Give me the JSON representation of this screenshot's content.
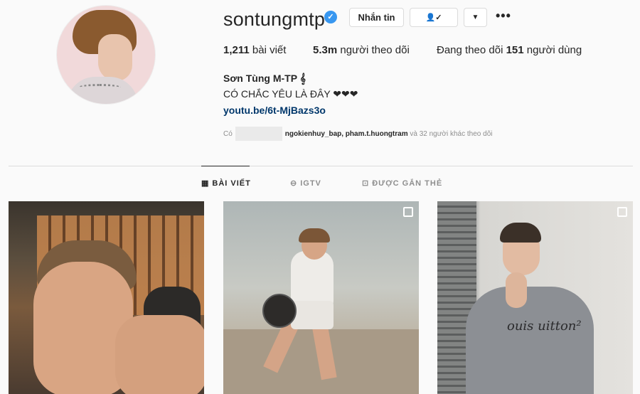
{
  "profile": {
    "username": "sontungmtp",
    "verified_symbol": "✓",
    "full_name": "Sơn Tùng M-TP 𝄞",
    "bio": "CÓ CHẮC YÊU LÀ ĐÂY ❤❤❤",
    "link": "youtu.be/6t-MjBazs3o"
  },
  "actions": {
    "message_label": "Nhắn tin",
    "following_icon": "👤✓",
    "dropdown_icon": "▼",
    "more_icon": "•••"
  },
  "stats": {
    "posts_count": "1,211",
    "posts_label": "bài viết",
    "followers_count": "5.3m",
    "followers_label": "người theo dõi",
    "following_prefix": "Đang theo dõi",
    "following_count": "151",
    "following_label": "người dùng"
  },
  "followed_by": {
    "prefix": "Có",
    "users": "ngokienhuy_bap, pham.t.huongtram",
    "suffix": "và 32 người khác theo dõi"
  },
  "tabs": [
    {
      "label": "BÀI VIẾT",
      "icon": "grid-icon",
      "glyph": "▦"
    },
    {
      "label": "IGTV",
      "icon": "igtv-icon",
      "glyph": "⊖"
    },
    {
      "label": "ĐƯỢC GẮN THẺ",
      "icon": "tagged-icon",
      "glyph": "⊡"
    }
  ],
  "posts": [
    {
      "multi": false
    },
    {
      "multi": true
    },
    {
      "multi": true,
      "sweater_text": "ouis uitton²"
    }
  ],
  "colors": {
    "verified": "#3897f0",
    "link": "#00376b",
    "muted": "#8e8e8e"
  }
}
